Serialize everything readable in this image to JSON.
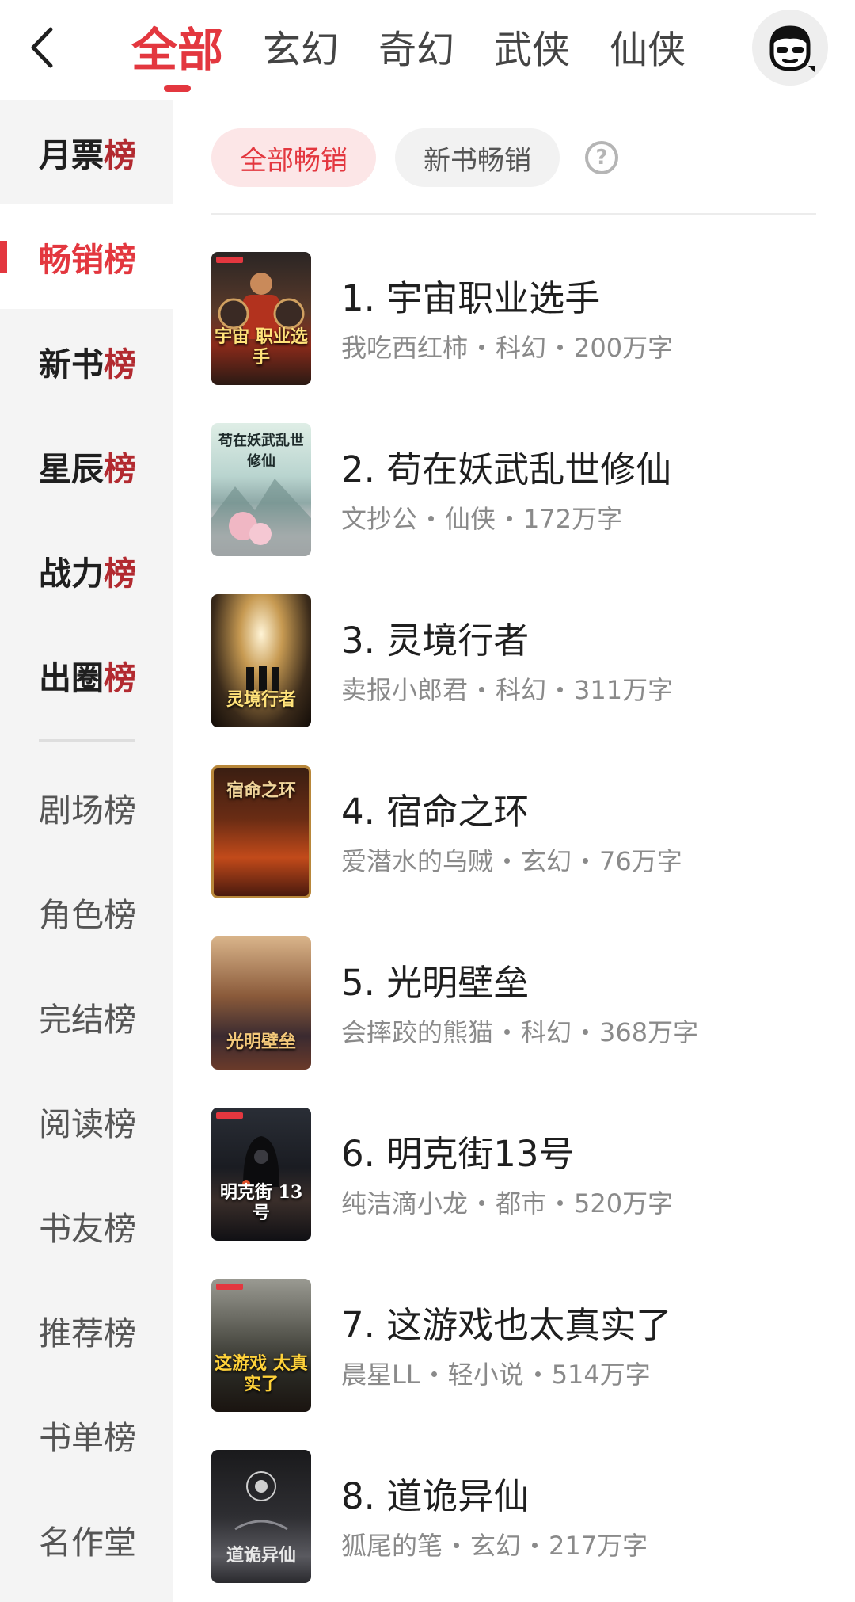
{
  "top_tabs": [
    {
      "label": "全部",
      "active": true
    },
    {
      "label": "玄幻",
      "active": false
    },
    {
      "label": "奇幻",
      "active": false
    },
    {
      "label": "武侠",
      "active": false
    },
    {
      "label": "仙侠",
      "active": false
    }
  ],
  "icons": {
    "back": "chevron-left-icon",
    "avatar": "user-avatar-icon",
    "help": "question-circle-icon"
  },
  "sidebar": {
    "items": [
      {
        "pre": "月票",
        "last": "榜"
      },
      {
        "pre": "畅销",
        "last": "榜"
      },
      {
        "pre": "新书",
        "last": "榜"
      },
      {
        "pre": "星辰",
        "last": "榜"
      },
      {
        "pre": "战力",
        "last": "榜"
      },
      {
        "pre": "出圈",
        "last": "榜"
      }
    ],
    "secondary": [
      "剧场榜",
      "角色榜",
      "完结榜",
      "阅读榜",
      "书友榜",
      "推荐榜",
      "书单榜",
      "名作堂"
    ],
    "active_index": 1
  },
  "filters": {
    "chips": [
      "全部畅销",
      "新书畅销"
    ],
    "active": 0,
    "help": "?"
  },
  "books": [
    {
      "title": "1. 宇宙职业选手",
      "author": "我吃西红柿",
      "genre": "科幻",
      "words": "200万字",
      "cover_text": "宇宙 职业选手"
    },
    {
      "title": "2. 苟在妖武乱世修仙",
      "author": "文抄公",
      "genre": "仙侠",
      "words": "172万字",
      "cover_text": "苟在妖武乱世 修仙"
    },
    {
      "title": "3. 灵境行者",
      "author": "卖报小郎君",
      "genre": "科幻",
      "words": "311万字",
      "cover_text": "灵境行者"
    },
    {
      "title": "4. 宿命之环",
      "author": "爱潜水的乌贼",
      "genre": "玄幻",
      "words": "76万字",
      "cover_text": "宿命之环"
    },
    {
      "title": "5. 光明壁垒",
      "author": "会摔跤的熊猫",
      "genre": "科幻",
      "words": "368万字",
      "cover_text": "光明壁垒"
    },
    {
      "title": "6. 明克街13号",
      "author": "纯洁滴小龙",
      "genre": "都市",
      "words": "520万字",
      "cover_text": "明克街 13号"
    },
    {
      "title": "7. 这游戏也太真实了",
      "author": "晨星LL",
      "genre": "轻小说",
      "words": "514万字",
      "cover_text": "这游戏 太真实了"
    },
    {
      "title": "8. 道诡异仙",
      "author": "狐尾的笔",
      "genre": "玄幻",
      "words": "217万字",
      "cover_text": "道诡异仙"
    }
  ],
  "colors": {
    "accent": "#e3373f",
    "sidebar_bg": "#f4f4f4",
    "meta_text": "#8a8a8a"
  }
}
